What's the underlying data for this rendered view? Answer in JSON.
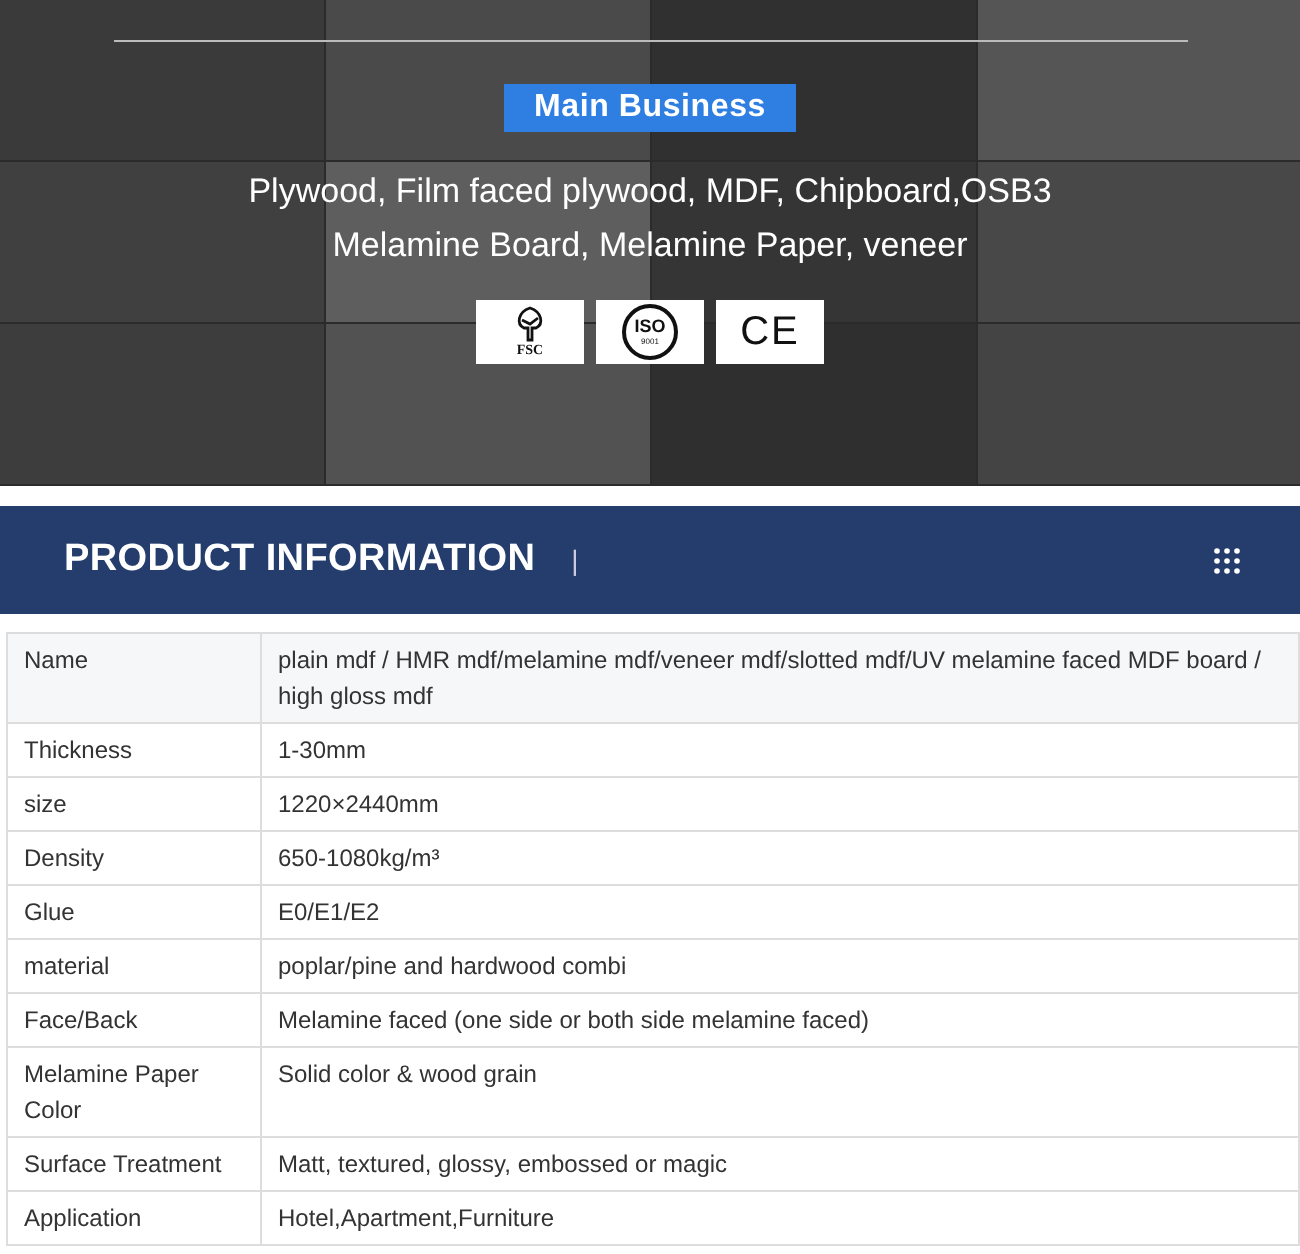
{
  "banner": {
    "kind": "picture",
    "badge": "Main Business",
    "lines": [
      "Plywood, Film faced plywood, MDF, Chipboard,OSB3",
      "Melamine Board, Melamine Paper, veneer"
    ],
    "certificates": [
      {
        "kind": "fsc",
        "texts": [
          "FSC"
        ]
      },
      {
        "kind": "iso",
        "texts": [
          "ISO",
          "9001"
        ]
      },
      {
        "kind": "ce",
        "texts": [
          "CE"
        ]
      }
    ]
  },
  "section": {
    "title": "PRODUCT INFORMATION",
    "divider": "|"
  },
  "table": {
    "rows": [
      {
        "label": "Name",
        "value": "plain mdf / HMR mdf/melamine mdf/veneer mdf/slotted mdf/UV melamine faced MDF board / high gloss mdf"
      },
      {
        "label": "Thickness",
        "value": "1-30mm"
      },
      {
        "label": "size",
        "value": "1220×2440mm"
      },
      {
        "label": "Density",
        "value": "650-1080kg/m³"
      },
      {
        "label": "Glue",
        "value": "E0/E1/E2"
      },
      {
        "label": "material",
        "value": "poplar/pine and hardwood combi"
      },
      {
        "label": "Face/Back",
        "value": "Melamine faced (one side or both side melamine faced)"
      },
      {
        "label": "Melamine Paper Color",
        "value": "Solid color & wood grain"
      },
      {
        "label": "Surface Treatment",
        "value": "Matt, textured, glossy, embossed or magic"
      },
      {
        "label": "Application",
        "value": "Hotel,Apartment,Furniture"
      }
    ]
  }
}
